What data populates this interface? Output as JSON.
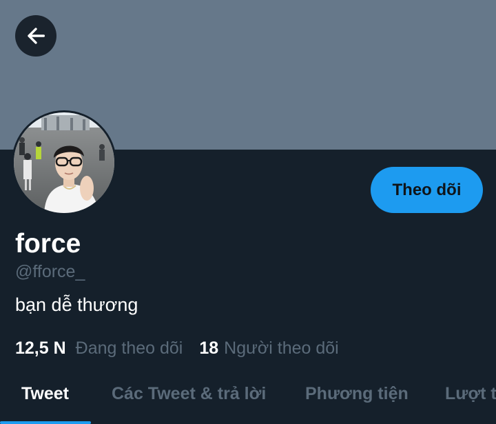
{
  "header": {
    "back_icon": "arrow-left-icon",
    "banner_color": "#66788a"
  },
  "profile": {
    "avatar_icon": "profile-photo",
    "display_name": "force",
    "handle": "@fforce_",
    "bio": "bạn dễ thương",
    "follow_label": "Theo dõi"
  },
  "stats": {
    "following_count": "12,5 N",
    "following_label": "Đang theo dõi",
    "followers_count": "18",
    "followers_label": "Người theo dõi"
  },
  "tabs": [
    {
      "label": "Tweet"
    },
    {
      "label": "Các Tweet & trả lời"
    },
    {
      "label": "Phương tiện"
    },
    {
      "label": "Lượt thích"
    }
  ],
  "colors": {
    "background": "#15202b",
    "accent": "#1d9bf0",
    "muted_text": "#5b6b7a"
  }
}
